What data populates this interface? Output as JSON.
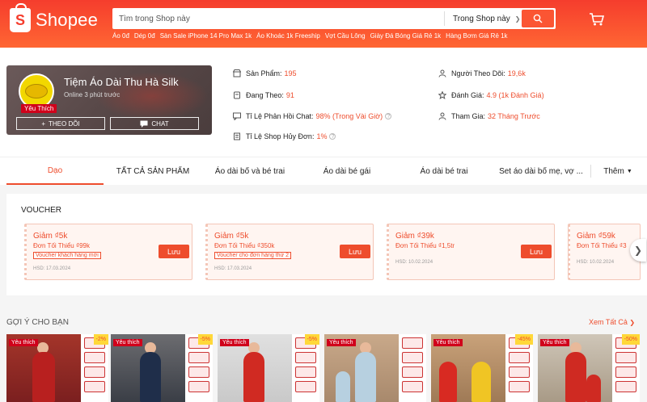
{
  "header": {
    "logo_text": "Shopee",
    "search_placeholder": "Tìm trong Shop này",
    "search_scope": "Trong Shop này",
    "keywords": [
      "Áo 0đ",
      "Dép 0đ",
      "Sàn Sale iPhone 14 Pro Max 1k",
      "Áo Khoác 1k Freeship",
      "Vợt Cầu Lông",
      "Giày Đá Bóng Giá Rẻ 1k",
      "Hàng Bơm Giá Rẻ 1k"
    ]
  },
  "shop": {
    "name": "Tiệm Áo Dài Thu Hà Silk",
    "online": "Online 3 phút trước",
    "badge": "Yêu Thích",
    "follow_label": "THEO DÕI",
    "chat_label": "CHAT",
    "stats": {
      "products": {
        "label": "Sản Phẩm:",
        "value": "195"
      },
      "following": {
        "label": "Đang Theo:",
        "value": "91"
      },
      "response": {
        "label": "Tỉ Lệ Phản Hồi Chat:",
        "value": "98% (Trong Vài Giờ)"
      },
      "cancel": {
        "label": "Tỉ Lệ Shop Hủy Đơn:",
        "value": "1%"
      },
      "followers": {
        "label": "Người Theo Dõi:",
        "value": "19,6k"
      },
      "rating": {
        "label": "Đánh Giá:",
        "value": "4.9 (1k Đánh Giá)"
      },
      "joined": {
        "label": "Tham Gia:",
        "value": "32 Tháng Trước"
      }
    }
  },
  "tabs": [
    "Dạo",
    "TẤT CẢ SẢN PHẨM",
    "Áo dài bố và bé trai",
    "Áo dài bé gái",
    "Áo dài bé trai",
    "Set áo dài bố mẹ, vợ ...",
    "Thêm"
  ],
  "voucher": {
    "section_title": "VOUCHER",
    "save_label": "Lưu",
    "items": [
      {
        "title": "Giảm ₫5k",
        "min": "Đơn Tối Thiểu ₫99k",
        "cond": "Voucher khách hàng mới",
        "exp": "HSD: 17.03.2024"
      },
      {
        "title": "Giảm ₫5k",
        "min": "Đơn Tối Thiểu ₫350k",
        "cond": "Voucher cho đơn hàng thứ 2",
        "exp": "HSD: 17.03.2024"
      },
      {
        "title": "Giảm ₫39k",
        "min": "Đơn Tối Thiểu ₫1,5tr",
        "cond": "",
        "exp": "HSD: 10.02.2024"
      },
      {
        "title": "Giảm ₫59k",
        "min": "Đơn Tối Thiểu ₫3",
        "cond": "",
        "exp": "HSD: 10.02.2024"
      }
    ]
  },
  "suggest": {
    "title": "GỢI Ý CHO BẠN",
    "see_all": "Xem Tất Cả",
    "products": [
      {
        "tag": "Yêu thích",
        "discount": "-2%"
      },
      {
        "tag": "Yêu thích",
        "discount": "-5%"
      },
      {
        "tag": "Yêu thích",
        "discount": "-5%"
      },
      {
        "tag": "Yêu thích",
        "discount": ""
      },
      {
        "tag": "Yêu thích",
        "discount": "-45%"
      },
      {
        "tag": "Yêu thích",
        "discount": "-50%"
      }
    ]
  },
  "colors": {
    "brand": "#ee4d2d",
    "header": "#f53d2d"
  }
}
